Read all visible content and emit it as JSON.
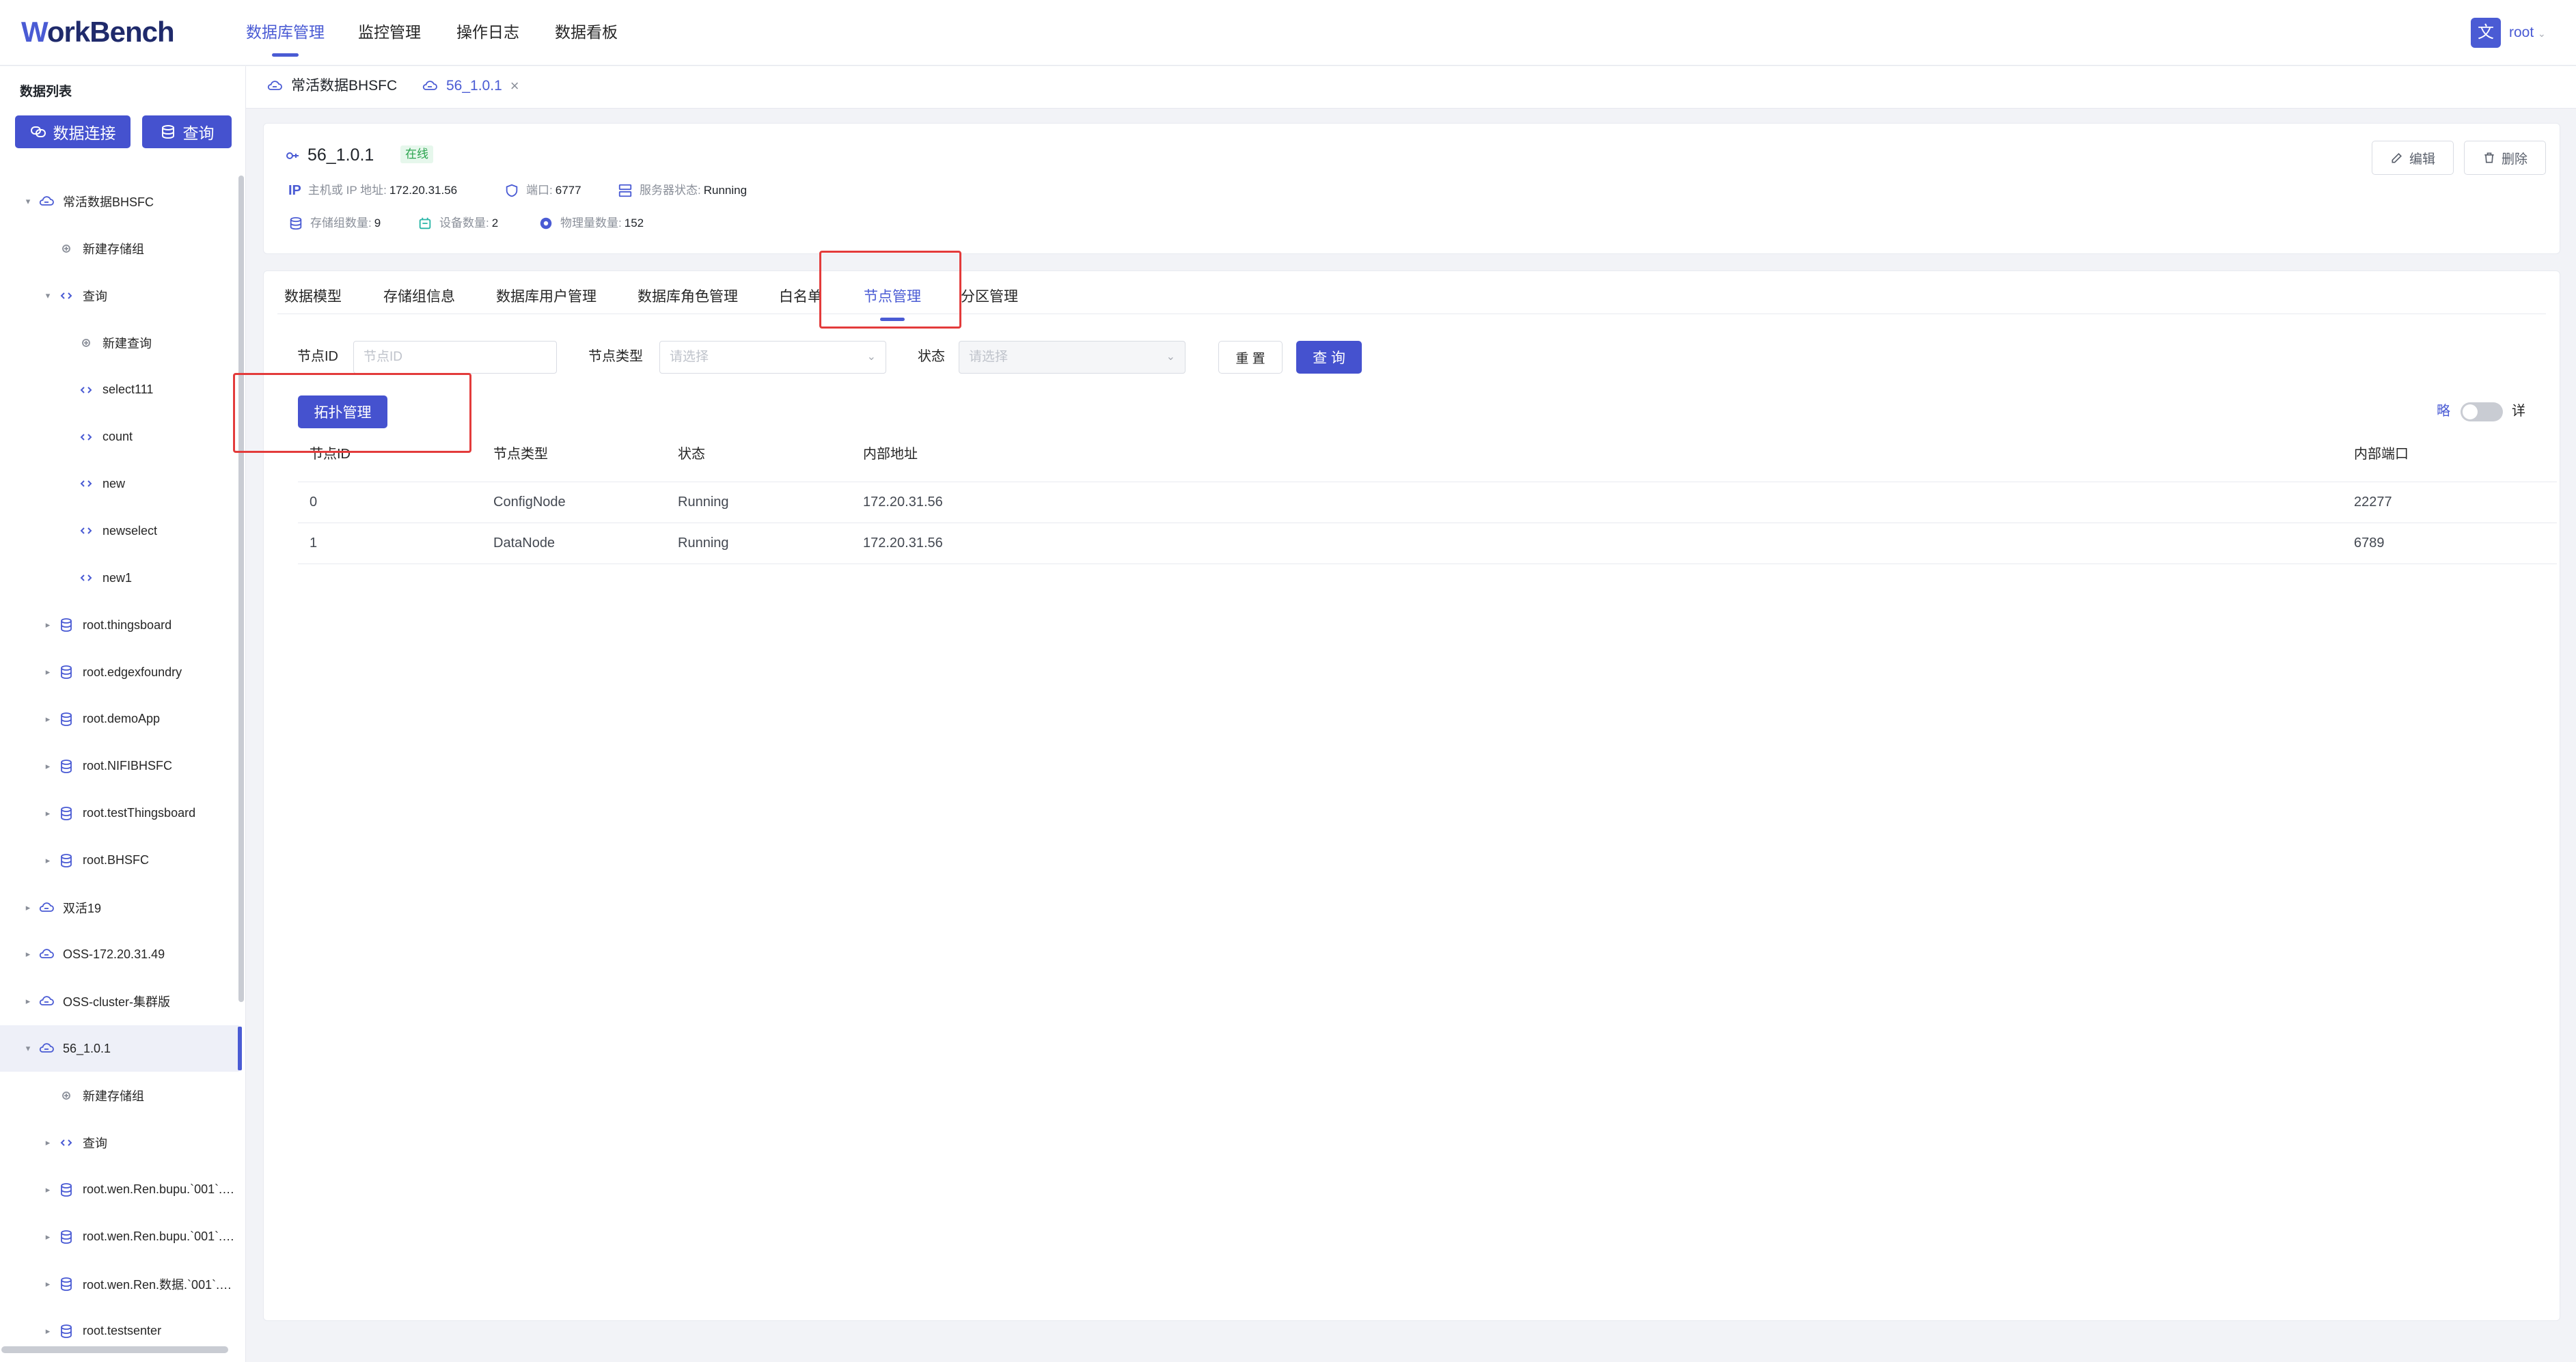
{
  "app": {
    "logo_a": "W",
    "logo_b": "orkBench",
    "nav": [
      {
        "label": "数据库管理",
        "active": true
      },
      {
        "label": "监控管理",
        "active": false
      },
      {
        "label": "操作日志",
        "active": false
      },
      {
        "label": "数据看板",
        "active": false
      }
    ],
    "user": {
      "avatar": "文",
      "name": "root"
    }
  },
  "sidebar": {
    "title": "数据列表",
    "connect_label": "数据连接",
    "query_label": "查询",
    "tree": [
      {
        "label": "常活数据BHSFC",
        "level": 0,
        "caret": "open",
        "icon": "cloud-db-icon"
      },
      {
        "label": "新建存储组",
        "level": 1,
        "caret": "",
        "icon": "plus-icon"
      },
      {
        "label": "查询",
        "level": 1,
        "caret": "open",
        "icon": "code-icon"
      },
      {
        "label": "新建查询",
        "level": 2,
        "caret": "",
        "icon": "plus-icon"
      },
      {
        "label": "select111",
        "level": 2,
        "caret": "",
        "icon": "code-icon"
      },
      {
        "label": "count",
        "level": 2,
        "caret": "",
        "icon": "code-icon"
      },
      {
        "label": "new",
        "level": 2,
        "caret": "",
        "icon": "code-icon"
      },
      {
        "label": "newselect",
        "level": 2,
        "caret": "",
        "icon": "code-icon"
      },
      {
        "label": "new1",
        "level": 2,
        "caret": "",
        "icon": "code-icon"
      },
      {
        "label": "root.thingsboard",
        "level": 1,
        "caret": "closed",
        "icon": "database-icon"
      },
      {
        "label": "root.edgexfoundry",
        "level": 1,
        "caret": "closed",
        "icon": "database-icon"
      },
      {
        "label": "root.demoApp",
        "level": 1,
        "caret": "closed",
        "icon": "database-icon"
      },
      {
        "label": "root.NIFIBHSFC",
        "level": 1,
        "caret": "closed",
        "icon": "database-icon"
      },
      {
        "label": "root.testThingsboard",
        "level": 1,
        "caret": "closed",
        "icon": "database-icon"
      },
      {
        "label": "root.BHSFC",
        "level": 1,
        "caret": "closed",
        "icon": "database-icon"
      },
      {
        "label": "双活19",
        "level": 0,
        "caret": "closed",
        "icon": "cloud-db-icon"
      },
      {
        "label": "OSS-172.20.31.49",
        "level": 0,
        "caret": "closed",
        "icon": "cloud-db-icon"
      },
      {
        "label": "OSS-cluster-集群版",
        "level": 0,
        "caret": "closed",
        "icon": "cloud-db-icon"
      },
      {
        "label": "56_1.0.1",
        "level": 0,
        "caret": "open",
        "icon": "cloud-db-icon",
        "selected": true
      },
      {
        "label": "新建存储组",
        "level": 1,
        "caret": "",
        "icon": "plus-icon"
      },
      {
        "label": "查询",
        "level": 1,
        "caret": "closed",
        "icon": "code-icon"
      },
      {
        "label": "root.wen.Ren.bupu.`001`.…",
        "level": 1,
        "caret": "closed",
        "icon": "database-icon"
      },
      {
        "label": "root.wen.Ren.bupu.`001`.…",
        "level": 1,
        "caret": "closed",
        "icon": "database-icon"
      },
      {
        "label": "root.wen.Ren.数据.`001`.A…",
        "level": 1,
        "caret": "closed",
        "icon": "database-icon"
      },
      {
        "label": "root.testsenter",
        "level": 1,
        "caret": "closed",
        "icon": "database-icon"
      }
    ]
  },
  "page_tabs": [
    {
      "label": "常活数据BHSFC",
      "active": false,
      "closable": false
    },
    {
      "label": "56_1.0.1",
      "active": true,
      "closable": true,
      "close": "×"
    }
  ],
  "instance": {
    "name": "56_1.0.1",
    "status": "在线",
    "host_label": "主机或 IP 地址:",
    "host_value": "172.20.31.56",
    "port_label": "端口:",
    "port_value": "6777",
    "server_status_label": "服务器状态:",
    "server_status_value": "Running",
    "storage_groups_label": "存储组数量:",
    "storage_groups_value": "9",
    "devices_label": "设备数量:",
    "devices_value": "2",
    "measurements_label": "物理量数量:",
    "measurements_value": "152",
    "ip_badge": "IP",
    "edit_label": "编辑",
    "delete_label": "删除"
  },
  "section_tabs": [
    {
      "label": "数据模型",
      "active": false
    },
    {
      "label": "存储组信息",
      "active": false
    },
    {
      "label": "数据库用户管理",
      "active": false
    },
    {
      "label": "数据库角色管理",
      "active": false
    },
    {
      "label": "白名单",
      "active": false
    },
    {
      "label": "节点管理",
      "active": true
    },
    {
      "label": "分区管理",
      "active": false
    }
  ],
  "filters": {
    "node_id_label": "节点ID",
    "node_id_placeholder": "节点ID",
    "node_type_label": "节点类型",
    "node_type_placeholder": "请选择",
    "status_label": "状态",
    "status_placeholder": "请选择",
    "reset_label": "重 置",
    "search_label": "查 询",
    "topology_label": "拓扑管理",
    "toggle_left": "略",
    "toggle_right": "详"
  },
  "table": {
    "columns": [
      "节点ID",
      "节点类型",
      "状态",
      "内部地址",
      "内部端口"
    ],
    "rows": [
      [
        "0",
        "ConfigNode",
        "Running",
        "172.20.31.56",
        "22277"
      ],
      [
        "1",
        "DataNode",
        "Running",
        "172.20.31.56",
        "6789"
      ]
    ]
  },
  "colors": {
    "brand": "#4a5bd4",
    "button": "#4552cf",
    "online_bg": "#e6f7ec",
    "online_text": "#2ba44e",
    "highlight": "#e33b3b"
  }
}
